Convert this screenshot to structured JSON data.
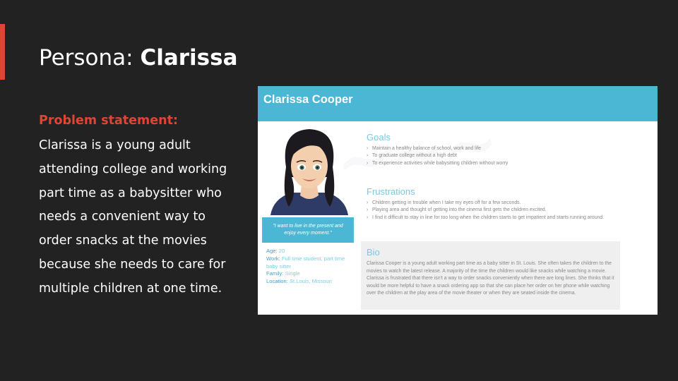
{
  "slide": {
    "title_prefix": "Persona: ",
    "title_name": "Clarissa",
    "accent_color": "#e04434",
    "background_color": "#222222"
  },
  "problem": {
    "label": "Problem statement:",
    "lines": [
      "Clarissa is a young adult",
      "attending college and working",
      "part time as a babysitter who",
      "needs a convenient way to",
      "order snacks at the movies",
      "because she needs to care for",
      "multiple children at one time."
    ]
  },
  "card": {
    "name": "Clarissa Cooper",
    "header_color": "#4cb7d4",
    "avatar_icon": "woman-avatar-icon",
    "quote": "\"I want to live in the present and enjoy every moment.\"",
    "facts": {
      "age_label": "Age:",
      "age_value": " 20",
      "work_label": "Work:",
      "work_value": " Full time student, part time baby sitter",
      "family_label": "Family:",
      "family_value": " Single",
      "location_label": "Location:",
      "location_value": " St.Louis, Missouri"
    },
    "goals": {
      "title": "Goals",
      "items": [
        "Maintain a healthy balance of school, work and life",
        "To graduate college without a high debt",
        "To experience activities while babysitting children without worry"
      ]
    },
    "frustrations": {
      "title": "Frustrations",
      "items": [
        "Children getting in trouble when I take my eyes off for a few seconds.",
        "Playing area and thought of getting into the cinema first gets the children excited.",
        "I find it difficult to stay in line for too long when the children starts to get impatient and starts running around."
      ]
    },
    "bio": {
      "title": "Bio",
      "text": "Clarissa Cooper is a young adult working part time as a baby sitter in St. Louis. She often takes the children to the movies to watch the latest release. A majority of the time the children would like snacks while watching a movie. Clarissa is frustrated that there isn't a way to order snacks conveniently when there are long lines. She thinks that it would be more helpful to have a snack ordering app so that she can place her order on her phone while watching over the children at the play area of the movie theater or when they are seated inside the cinema."
    }
  }
}
